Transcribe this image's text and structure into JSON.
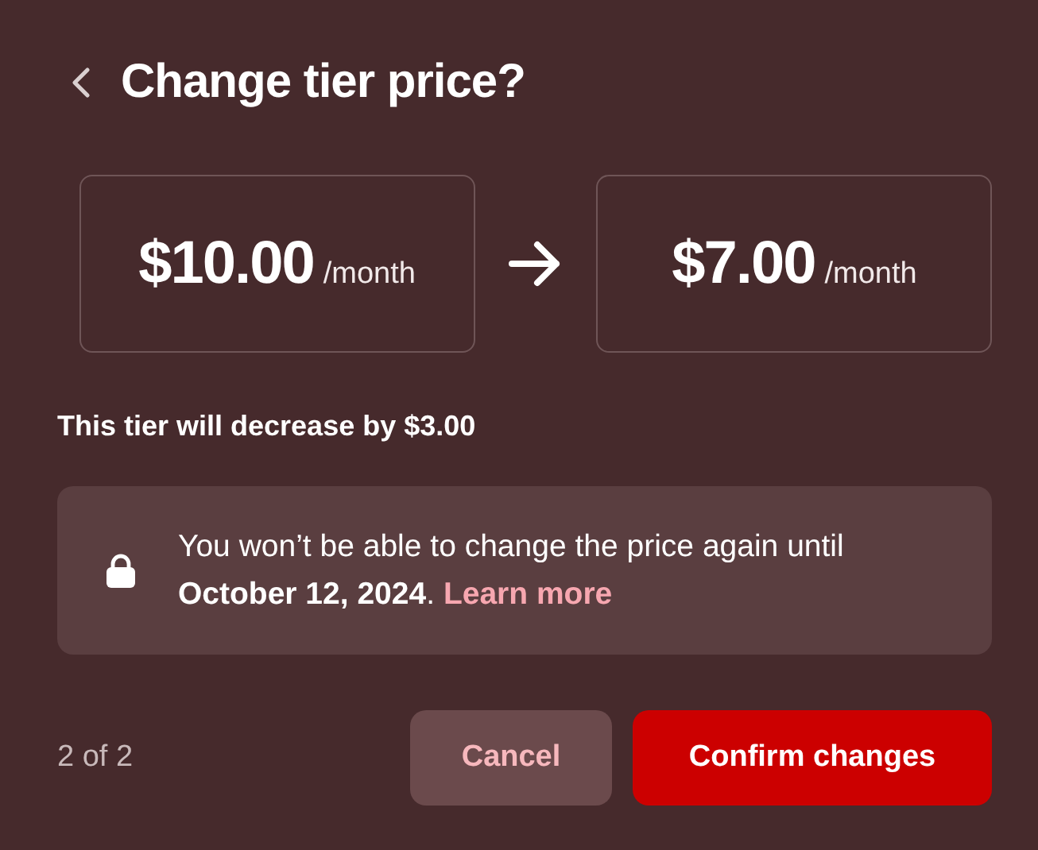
{
  "dialog": {
    "title": "Change tier price?"
  },
  "prices": [
    {
      "amount": "$10.00",
      "period": "/month"
    },
    {
      "amount": "$7.00",
      "period": "/month"
    }
  ],
  "summary": "This tier will decrease by $3.00",
  "notice": {
    "text": "You won’t be able to change the price again until **October 12, 2024**.",
    "link": "Learn more"
  },
  "footer": {
    "step": "2 of 2",
    "buttons": [
      {
        "label": "Cancel",
        "kind": "secondary"
      },
      {
        "label": "Confirm changes",
        "kind": "primary"
      }
    ]
  }
}
